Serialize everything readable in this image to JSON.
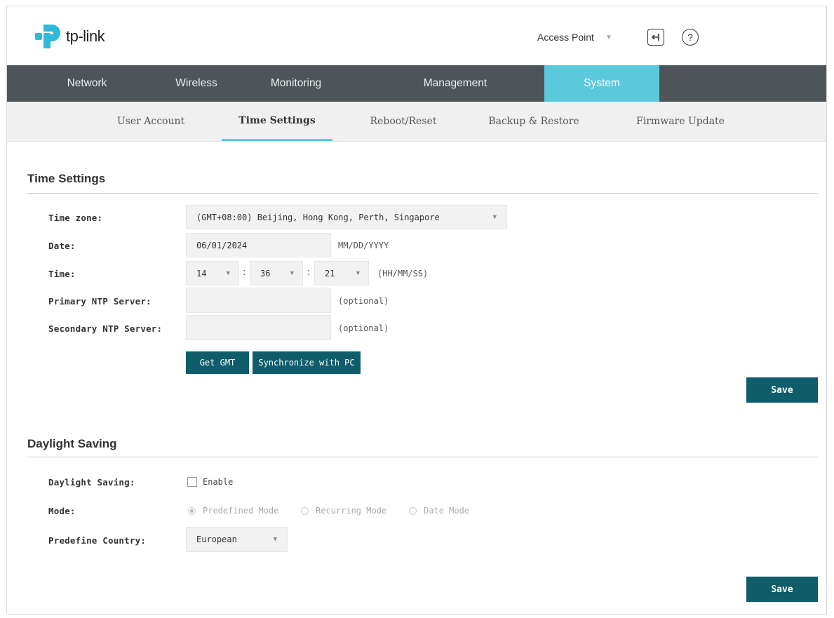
{
  "brand": {
    "name": "tp-link",
    "primary_color": "#2dbad8"
  },
  "header": {
    "mode": "Access Point",
    "logout_icon": "logout-icon",
    "help_icon": "help-icon"
  },
  "main_nav": {
    "tabs": [
      {
        "label": "Network"
      },
      {
        "label": "Wireless"
      },
      {
        "label": "Monitoring"
      },
      {
        "label": "Management"
      },
      {
        "label": "System",
        "active": true
      }
    ]
  },
  "sub_nav": {
    "tabs": [
      {
        "label": "User Account"
      },
      {
        "label": "Time Settings",
        "active": true
      },
      {
        "label": "Reboot/Reset"
      },
      {
        "label": "Backup & Restore"
      },
      {
        "label": "Firmware Update"
      }
    ]
  },
  "time_settings": {
    "title": "Time Settings",
    "time_zone": {
      "label": "Time zone:",
      "value": "(GMT+08:00) Beijing, Hong Kong, Perth, Singapore"
    },
    "date": {
      "label": "Date:",
      "value": "06/01/2024",
      "format": "MM/DD/YYYY"
    },
    "time": {
      "label": "Time:",
      "hh": "14",
      "mm": "36",
      "ss": "21",
      "format": "(HH/MM/SS)",
      "sep": ":"
    },
    "primary_ntp": {
      "label": "Primary NTP Server:",
      "value": "",
      "hint": "(optional)"
    },
    "secondary_ntp": {
      "label": "Secondary NTP Server:",
      "value": "",
      "hint": "(optional)"
    },
    "get_gmt_label": "Get GMT",
    "sync_pc_label": "Synchronize with PC",
    "save_label": "Save"
  },
  "daylight_saving": {
    "title": "Daylight Saving",
    "enable": {
      "label": "Daylight Saving:",
      "checkbox_label": "Enable",
      "checked": false
    },
    "mode": {
      "label": "Mode:",
      "options": [
        "Predefined Mode",
        "Recurring Mode",
        "Date Mode"
      ],
      "selected": "Predefined Mode"
    },
    "country": {
      "label": "Predefine Country:",
      "value": "European"
    },
    "save_label": "Save"
  },
  "colors": {
    "nav_bg": "#4d5558",
    "active_tab": "#5bc8dc",
    "button": "#0f5d6b"
  }
}
